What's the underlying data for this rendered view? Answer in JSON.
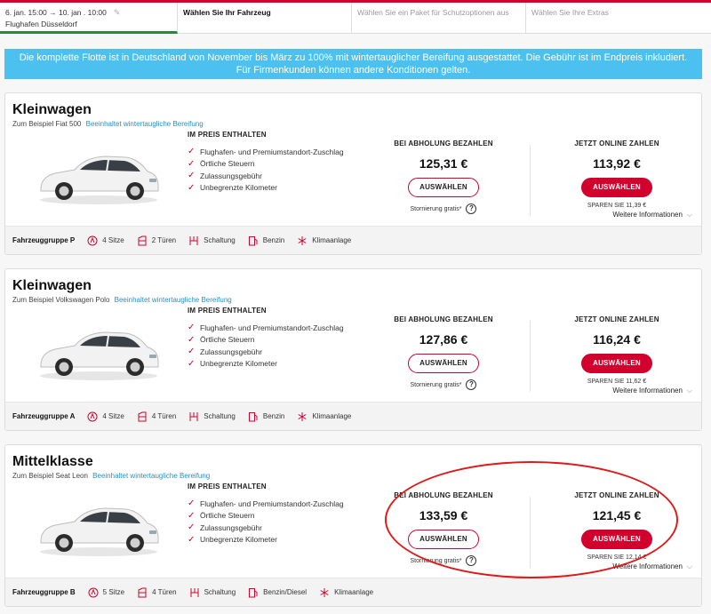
{
  "header": {
    "step1": {
      "dates": "6. jan. 15:00 → 10. jan . 10:00",
      "location": "Flughafen Düsseldorf"
    },
    "step2": "Wählen Sie Ihr Fahrzeug",
    "step3": "Wählen Sie ein Paket für Schutzoptionen aus",
    "step4": "Wählen Sie Ihre Extras"
  },
  "banner": "Die komplette Flotte ist in Deutschland von November bis März zu 100% mit wintertauglicher Bereifung ausgestattet. Die Gebühr ist im Endpreis inkludiert. Für Firmenkunden können andere Konditionen gelten.",
  "labels": {
    "included_head": "IM PREIS ENTHALTEN",
    "pay_pickup": "BEI ABHOLUNG BEZAHLEN",
    "pay_online": "JETZT ONLINE ZAHLEN",
    "select": "AUSWÄHLEN",
    "cancel_free": "Stornierung gratis*",
    "more_info": "Weitere Informationen",
    "winter_link": "Beeinhaltet wintertaugliche Bereifung"
  },
  "included": [
    "Flughafen- und Premiumstandort-Zuschlag",
    "Örtliche Steuern",
    "Zulassungsgebühr",
    "Unbegrenzte Kilometer"
  ],
  "cars": [
    {
      "category": "Kleinwagen",
      "example": "Zum Beispiel Fiat 500",
      "price_pickup": "125,31 €",
      "price_online": "113,92 €",
      "savings": "SPAREN SIE 11,39 €",
      "group": "Fahrzeuggruppe P",
      "seats": "4 Sitze",
      "doors": "2 Türen",
      "transmission": "Schaltung",
      "fuel": "Benzin",
      "ac": "Klimaanlage"
    },
    {
      "category": "Kleinwagen",
      "example": "Zum Beispiel Volkswagen Polo",
      "price_pickup": "127,86 €",
      "price_online": "116,24 €",
      "savings": "SPAREN SIE 11,62 €",
      "group": "Fahrzeuggruppe A",
      "seats": "4 Sitze",
      "doors": "4 Türen",
      "transmission": "Schaltung",
      "fuel": "Benzin",
      "ac": "Klimaanlage"
    },
    {
      "category": "Mittelklasse",
      "example": "Zum Beispiel Seat Leon",
      "price_pickup": "133,59 €",
      "price_online": "121,45 €",
      "savings": "SPAREN SIE 12,14 €",
      "group": "Fahrzeuggruppe B",
      "seats": "5 Sitze",
      "doors": "4 Türen",
      "transmission": "Schaltung",
      "fuel": "Benzin/Diesel",
      "ac": "Klimaanlage"
    }
  ],
  "colors": {
    "accent": "#d1002c",
    "banner": "#4cc0ef",
    "link": "#2a8fc4",
    "progress": "#2e8540",
    "annotation": "#e01818"
  }
}
